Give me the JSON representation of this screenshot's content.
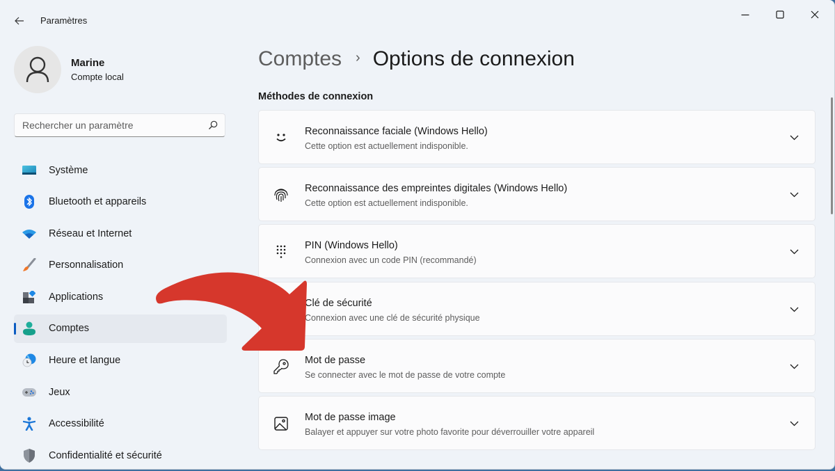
{
  "window": {
    "title": "Paramètres",
    "controls": {
      "minimize": "minimize",
      "maximize": "maximize",
      "close": "close"
    }
  },
  "profile": {
    "name": "Marine",
    "account_type": "Compte local"
  },
  "search": {
    "placeholder": "Rechercher un paramètre",
    "value": ""
  },
  "sidebar": {
    "active_index": 5,
    "items": [
      {
        "label": "Système",
        "icon": "system-display-icon"
      },
      {
        "label": "Bluetooth et appareils",
        "icon": "bluetooth-icon"
      },
      {
        "label": "Réseau et Internet",
        "icon": "wifi-icon"
      },
      {
        "label": "Personnalisation",
        "icon": "paintbrush-icon"
      },
      {
        "label": "Applications",
        "icon": "apps-icon"
      },
      {
        "label": "Comptes",
        "icon": "person-icon"
      },
      {
        "label": "Heure et langue",
        "icon": "time-language-icon"
      },
      {
        "label": "Jeux",
        "icon": "gamepad-icon"
      },
      {
        "label": "Accessibilité",
        "icon": "accessibility-icon"
      },
      {
        "label": "Confidentialité et sécurité",
        "icon": "shield-icon"
      }
    ]
  },
  "breadcrumb": {
    "parent": "Comptes",
    "separator": "›",
    "current": "Options de connexion"
  },
  "section": {
    "title": "Méthodes de connexion"
  },
  "methods": [
    {
      "title": "Reconnaissance faciale (Windows Hello)",
      "subtitle": "Cette option est actuellement indisponible.",
      "icon": "face-icon"
    },
    {
      "title": "Reconnaissance des empreintes digitales (Windows Hello)",
      "subtitle": "Cette option est actuellement indisponible.",
      "icon": "fingerprint-icon"
    },
    {
      "title": "PIN (Windows Hello)",
      "subtitle": "Connexion avec un code PIN (recommandé)",
      "icon": "pin-keypad-icon"
    },
    {
      "title": "Clé de sécurité",
      "subtitle": "Connexion avec une clé de sécurité physique",
      "icon": "usb-key-icon"
    },
    {
      "title": "Mot de passe",
      "subtitle": "Se connecter avec le mot de passe de votre compte",
      "icon": "key-icon"
    },
    {
      "title": "Mot de passe image",
      "subtitle": "Balayer et appuyer sur votre photo favorite pour déverrouiller votre appareil",
      "icon": "picture-icon"
    }
  ],
  "annotation": {
    "type": "curved-arrow",
    "color": "#d6372c",
    "points_to": "Mot de passe"
  },
  "colors": {
    "accent": "#0b5cc1",
    "window_bg": "#eff3f8",
    "card_bg": "#fbfbfc"
  }
}
